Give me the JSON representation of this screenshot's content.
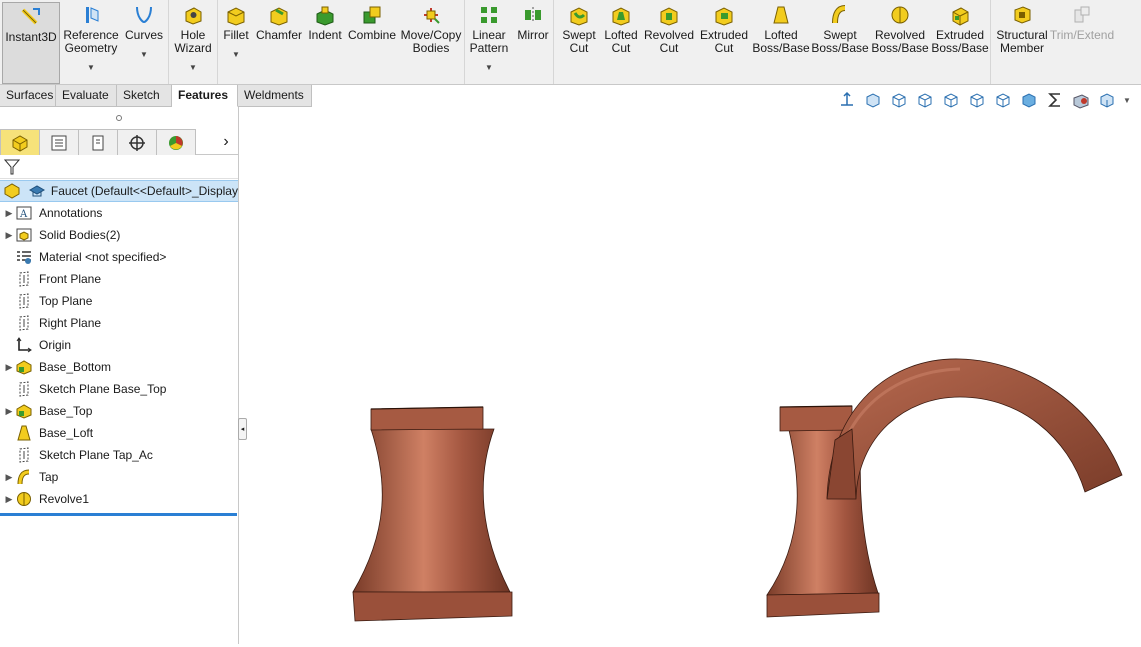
{
  "ribbon": {
    "buttons": [
      {
        "id": "instant3d",
        "label": "Instant3D"
      },
      {
        "id": "reference-geometry",
        "label": "Reference Geometry"
      },
      {
        "id": "curves",
        "label": "Curves"
      },
      {
        "id": "hole-wizard",
        "label": "Hole Wizard"
      },
      {
        "id": "fillet",
        "label": "Fillet"
      },
      {
        "id": "chamfer",
        "label": "Chamfer"
      },
      {
        "id": "indent",
        "label": "Indent"
      },
      {
        "id": "combine",
        "label": "Combine"
      },
      {
        "id": "move-copy-bodies",
        "label": "Move/Copy Bodies"
      },
      {
        "id": "linear-pattern",
        "label": "Linear Pattern"
      },
      {
        "id": "mirror",
        "label": "Mirror"
      },
      {
        "id": "swept-cut",
        "label": "Swept Cut"
      },
      {
        "id": "lofted-cut",
        "label": "Lofted Cut"
      },
      {
        "id": "revolved-cut",
        "label": "Revolved Cut"
      },
      {
        "id": "extruded-cut",
        "label": "Extruded Cut"
      },
      {
        "id": "lofted-boss-base",
        "label": "Lofted Boss/Base"
      },
      {
        "id": "swept-boss-base",
        "label": "Swept Boss/Base"
      },
      {
        "id": "revolved-boss-base",
        "label": "Revolved Boss/Base"
      },
      {
        "id": "extruded-boss-base",
        "label": "Extruded Boss/Base"
      },
      {
        "id": "structural-member",
        "label": "Structural Member"
      },
      {
        "id": "trim-extend",
        "label": "Trim/Extend"
      }
    ]
  },
  "tabs": [
    {
      "label": "Surfaces"
    },
    {
      "label": "Evaluate"
    },
    {
      "label": "Sketch"
    },
    {
      "label": "Features",
      "active": true
    },
    {
      "label": "Weldments"
    }
  ],
  "tree": {
    "root": "Faucet  (Default<<Default>_Display",
    "items": [
      {
        "label": "Annotations",
        "expandable": true,
        "icon": "annotations-icon"
      },
      {
        "label": "Solid Bodies(2)",
        "expandable": true,
        "icon": "solid-bodies-icon"
      },
      {
        "label": "Material <not specified>",
        "expandable": false,
        "icon": "material-icon"
      },
      {
        "label": "Front Plane",
        "expandable": false,
        "icon": "plane-icon"
      },
      {
        "label": "Top Plane",
        "expandable": false,
        "icon": "plane-icon"
      },
      {
        "label": "Right Plane",
        "expandable": false,
        "icon": "plane-icon"
      },
      {
        "label": "Origin",
        "expandable": false,
        "icon": "origin-icon"
      },
      {
        "label": "Base_Bottom",
        "expandable": true,
        "icon": "extrude-icon"
      },
      {
        "label": "Sketch Plane Base_Top",
        "expandable": false,
        "icon": "plane-icon"
      },
      {
        "label": "Base_Top",
        "expandable": true,
        "icon": "extrude-icon"
      },
      {
        "label": "Base_Loft",
        "expandable": false,
        "icon": "loft-icon"
      },
      {
        "label": "Sketch Plane Tap_Ac",
        "expandable": false,
        "icon": "plane-icon"
      },
      {
        "label": "Tap",
        "expandable": true,
        "icon": "sweep-icon"
      },
      {
        "label": "Revolve1",
        "expandable": true,
        "icon": "revolve-icon"
      }
    ]
  },
  "colors": {
    "copper": "#a0563f",
    "copper_light": "#c87a62",
    "copper_dark": "#6e3524",
    "accent_blue": "#2a7fd4",
    "feature_yellow": "#f2cc1e",
    "feature_green": "#3a9a2e"
  }
}
